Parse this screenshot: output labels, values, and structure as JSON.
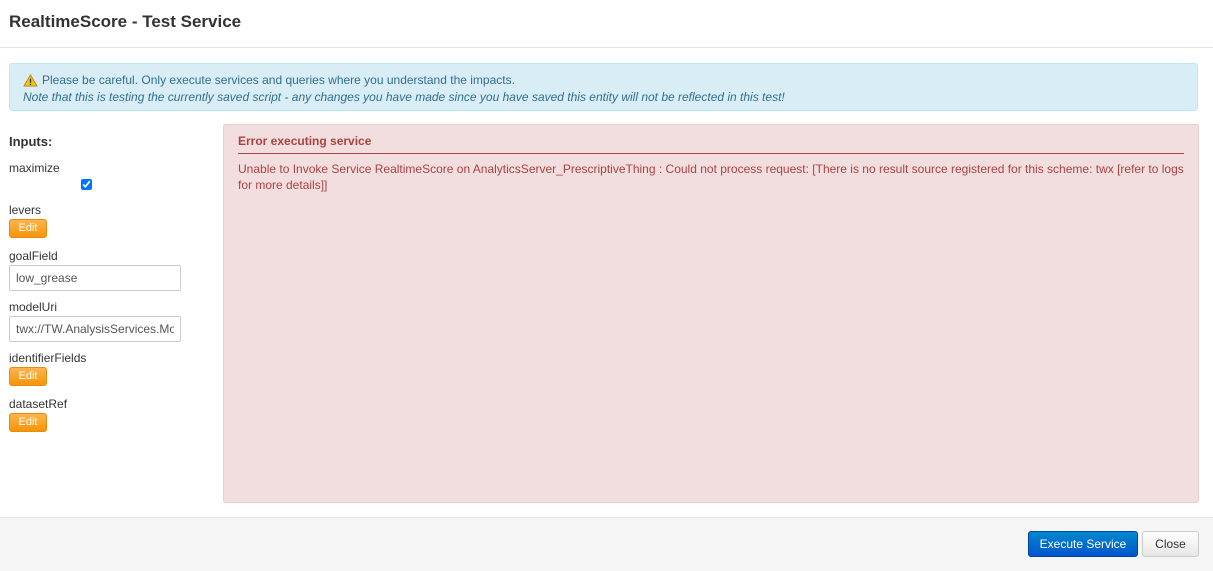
{
  "header": {
    "title": "RealtimeScore - Test Service"
  },
  "warning": {
    "icon": "warning-icon",
    "line1": "Please be careful. Only execute services and queries where you understand the impacts.",
    "line2": "Note that this is testing the currently saved script - any changes you have made since you have saved this entity will not be reflected in this test!"
  },
  "inputs": {
    "heading": "Inputs:",
    "maximize_label": "maximize",
    "levers_label": "levers",
    "goalField_label": "goalField",
    "goalField_value": "low_grease",
    "modelUri_label": "modelUri",
    "modelUri_value": "twx://TW.AnalysisServices.Moc",
    "identifierFields_label": "identifierFields",
    "datasetRef_label": "datasetRef",
    "edit_label": "Edit"
  },
  "error": {
    "title": "Error executing service",
    "message": "Unable to Invoke Service RealtimeScore on AnalyticsServer_PrescriptiveThing : Could not process request: [There is no result source registered for this scheme: twx [refer to logs for more details]]"
  },
  "footer": {
    "execute_label": "Execute Service",
    "close_label": "Close"
  },
  "colors": {
    "accent": "#0055cc",
    "edit": "#f89406",
    "error_text": "#a94442",
    "info_bg": "#d9edf7"
  }
}
